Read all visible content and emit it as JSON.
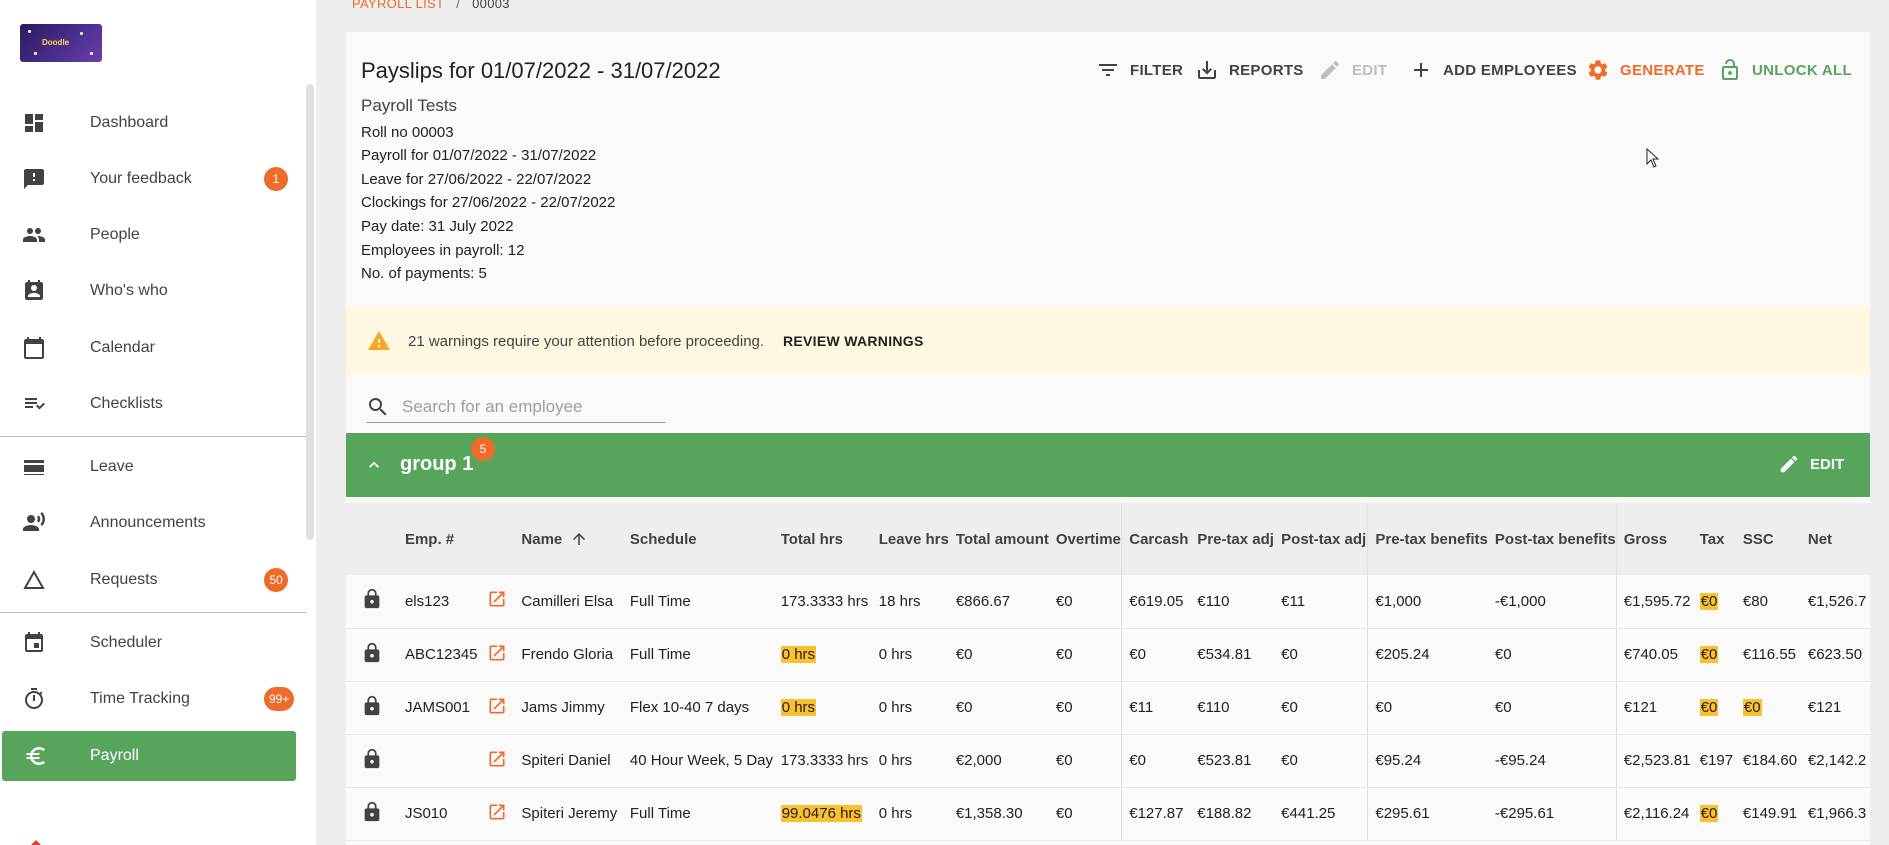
{
  "sidebar": {
    "logo_text": "Doodle",
    "items": [
      {
        "label": "Dashboard",
        "icon": "dashboard-icon"
      },
      {
        "label": "Your feedback",
        "icon": "feedback-icon",
        "badge": "1"
      },
      {
        "label": "People",
        "icon": "people-icon"
      },
      {
        "label": "Who's who",
        "icon": "badge-icon"
      },
      {
        "label": "Calendar",
        "icon": "calendar-icon"
      },
      {
        "label": "Checklists",
        "icon": "checklist-icon"
      },
      {
        "label": "Leave",
        "icon": "leave-icon"
      },
      {
        "label": "Announcements",
        "icon": "announcement-icon"
      },
      {
        "label": "Requests",
        "icon": "requests-icon",
        "badge": "50"
      },
      {
        "label": "Scheduler",
        "icon": "scheduler-icon"
      },
      {
        "label": "Time Tracking",
        "icon": "timer-icon",
        "badge": "99+"
      },
      {
        "label": "Payroll",
        "icon": "euro-icon",
        "active": true
      }
    ]
  },
  "breadcrumb": {
    "link": "PAYROLL LIST",
    "separator": "/",
    "current": "00003"
  },
  "header": {
    "title": "Payslips for 01/07/2022 - 31/07/2022",
    "subtitle": "Payroll Tests",
    "lines": [
      "Roll no 00003",
      "Payroll for 01/07/2022 - 31/07/2022",
      "Leave for 27/06/2022 - 22/07/2022",
      "Clockings for 27/06/2022 - 22/07/2022",
      "Pay date: 31 July 2022",
      "Employees in payroll: 12",
      "No. of payments: 5"
    ]
  },
  "toolbar": {
    "filter": "FILTER",
    "reports": "REPORTS",
    "edit": "EDIT",
    "add_employees": "ADD EMPLOYEES",
    "generate": "GENERATE",
    "unlock_all": "UNLOCK ALL"
  },
  "warning": {
    "text": "21 warnings require your attention before proceeding.",
    "button": "REVIEW WARNINGS"
  },
  "search": {
    "placeholder": "Search for an employee"
  },
  "group": {
    "name": "group 1",
    "count": "5",
    "edit": "EDIT"
  },
  "colors": {
    "accent_orange": "#ee6b2a",
    "accent_green": "#57a55a",
    "highlight": "#fbc02d",
    "warning_bg": "#fff8e1"
  },
  "table": {
    "headers": [
      "Emp. #",
      "Name",
      "Schedule",
      "Total hrs",
      "Leave hrs",
      "Total amount",
      "Overtime",
      "Carcash",
      "Pre-tax adj",
      "Post-tax adj",
      "Pre-tax benefits",
      "Post-tax benefits",
      "Gross",
      "Tax",
      "SSC",
      "Net"
    ],
    "sort_column": "Name",
    "rows": [
      {
        "emp": "els123",
        "name": "Camilleri Elsa",
        "schedule": "Full Time",
        "total_hrs": "173.3333 hrs",
        "leave_hrs": "18 hrs",
        "total_amount": "€866.67",
        "overtime": "€0",
        "carcash": "€619.05",
        "pretax_adj": "€110",
        "posttax_adj": "€11",
        "pretax_ben": "€1,000",
        "posttax_ben": "-€1,000",
        "gross": "€1,595.72",
        "tax": "€0",
        "ssc": "€80",
        "net": "€1,526.7"
      },
      {
        "emp": "ABC12345",
        "name": "Frendo Gloria",
        "schedule": "Full Time",
        "total_hrs": "0 hrs",
        "leave_hrs": "0 hrs",
        "total_amount": "€0",
        "overtime": "€0",
        "carcash": "€0",
        "pretax_adj": "€534.81",
        "posttax_adj": "€0",
        "pretax_ben": "€205.24",
        "posttax_ben": "€0",
        "gross": "€740.05",
        "tax": "€0",
        "ssc": "€116.55",
        "net": "€623.50"
      },
      {
        "emp": "JAMS001",
        "name": "Jams Jimmy",
        "schedule": "Flex 10-40 7 days",
        "total_hrs": "0 hrs",
        "leave_hrs": "0 hrs",
        "total_amount": "€0",
        "overtime": "€0",
        "carcash": "€11",
        "pretax_adj": "€110",
        "posttax_adj": "€0",
        "pretax_ben": "€0",
        "posttax_ben": "€0",
        "gross": "€121",
        "tax": "€0",
        "ssc": "€0",
        "net": "€121"
      },
      {
        "emp": "",
        "name": "Spiteri Daniel",
        "schedule": "40 Hour Week, 5 Day",
        "total_hrs": "173.3333 hrs",
        "leave_hrs": "0 hrs",
        "total_amount": "€2,000",
        "overtime": "€0",
        "carcash": "€0",
        "pretax_adj": "€523.81",
        "posttax_adj": "€0",
        "pretax_ben": "€95.24",
        "posttax_ben": "-€95.24",
        "gross": "€2,523.81",
        "tax": "€197",
        "ssc": "€184.60",
        "net": "€2,142.2"
      },
      {
        "emp": "JS010",
        "name": "Spiteri Jeremy",
        "schedule": "Full Time",
        "total_hrs": "99.0476 hrs",
        "leave_hrs": "0 hrs",
        "total_amount": "€1,358.30",
        "overtime": "€0",
        "carcash": "€127.87",
        "pretax_adj": "€188.82",
        "posttax_adj": "€441.25",
        "pretax_ben": "€295.61",
        "posttax_ben": "-€295.61",
        "gross": "€2,116.24",
        "tax": "€0",
        "ssc": "€149.91",
        "net": "€1,966.3"
      }
    ]
  }
}
